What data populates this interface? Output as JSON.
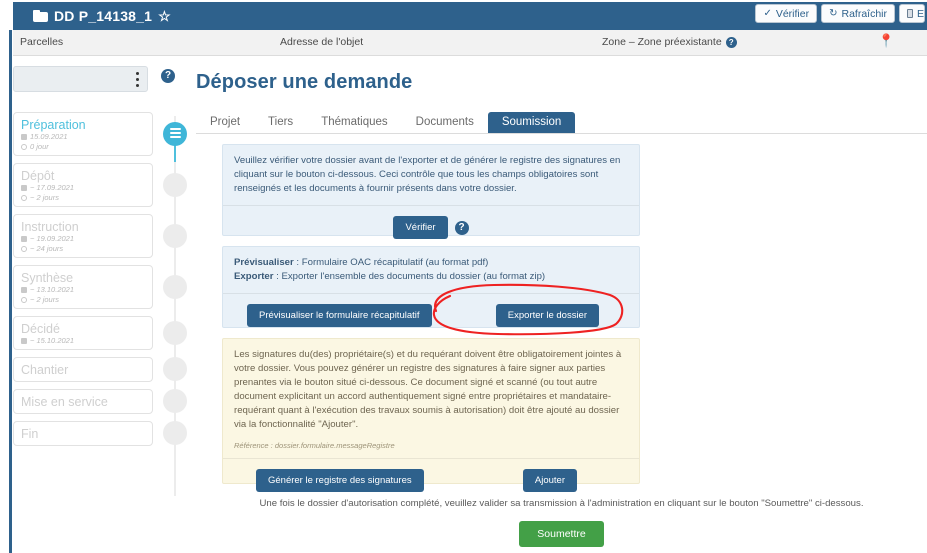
{
  "window": {
    "title": "DD P_14138_1",
    "folder_icon": "folder-icon",
    "favorite_icon": "star-icon"
  },
  "toolbar": {
    "verify_label": "Vérifier",
    "refresh_label": "Rafraîchir",
    "third_label": "E",
    "check_icon": "check-icon",
    "refresh_icon": "refresh-icon",
    "doc_icon": "document-icon"
  },
  "subheader": {
    "parcelles": "Parcelles",
    "adresse": "Adresse de l'objet",
    "zone": "Zone – Zone préexistante",
    "zone_help": "?",
    "pin_icon": "map-pin-icon"
  },
  "sidebar": {
    "help_icon_label": "?",
    "kebab_label": "more-options",
    "steps": [
      {
        "name": "Préparation",
        "date": "15.09.2021",
        "duration": "0 jour",
        "state": "active"
      },
      {
        "name": "Dépôt",
        "date": "~ 17.09.2021",
        "duration": "~ 2 jours",
        "state": "pending"
      },
      {
        "name": "Instruction",
        "date": "~ 19.09.2021",
        "duration": "~ 24 jours",
        "state": "pending"
      },
      {
        "name": "Synthèse",
        "date": "~ 13.10.2021",
        "duration": "~ 2 jours",
        "state": "pending"
      },
      {
        "name": "Décidé",
        "date": "~ 15.10.2021",
        "duration": "",
        "state": "pending"
      },
      {
        "name": "Chantier",
        "date": "",
        "duration": "",
        "state": "pending"
      },
      {
        "name": "Mise en service",
        "date": "",
        "duration": "",
        "state": "pending"
      },
      {
        "name": "Fin",
        "date": "",
        "duration": "",
        "state": "pending"
      }
    ]
  },
  "main": {
    "title": "Déposer une demande",
    "tabs": [
      {
        "label": "Projet",
        "active": false
      },
      {
        "label": "Tiers",
        "active": false
      },
      {
        "label": "Thématiques",
        "active": false
      },
      {
        "label": "Documents",
        "active": false
      },
      {
        "label": "Soumission",
        "active": true
      }
    ],
    "panel_verify": {
      "text": "Veuillez vérifier votre dossier avant de l'exporter et de générer le registre des signatures en cliquant sur le bouton ci-dessous. Ceci contrôle que tous les champs obligatoires sont renseignés et les documents à fournir présents dans votre dossier.",
      "button": "Vérifier",
      "help": "?"
    },
    "panel_export": {
      "line1_label": "Prévisualiser",
      "line1_text": " : Formulaire OAC récapitulatif (au format pdf)",
      "line2_label": "Exporter",
      "line2_text": " : Exporter l'ensemble des documents du dossier (au format zip)",
      "button_preview": "Prévisualiser le formulaire récapitulatif",
      "button_export": "Exporter le dossier"
    },
    "panel_signatures": {
      "text": "Les signatures du(des) propriétaire(s) et du requérant doivent être obligatoirement jointes à votre dossier. Vous pouvez générer un registre des signatures à faire signer aux parties prenantes via le bouton situé ci-dessous. Ce document signé et scanné (ou tout autre document explicitant un accord authentiquement signé entre propriétaires et mandataire-requérant quant à l'exécution des travaux soumis à autorisation) doit être ajouté au dossier via la fonctionnalité \"Ajouter\".",
      "reference": "Référence : dossier.formulaire.messageRegistre",
      "button_generate": "Générer le registre des signatures",
      "button_add": "Ajouter"
    },
    "footer": {
      "note": "Une fois le dossier d'autorisation complété, veuillez valider sa transmission à l'administration en cliquant sur le bouton \"Soumettre\" ci-dessous.",
      "submit_label": "Soumettre"
    }
  },
  "annotation": {
    "shape": "red-ellipse",
    "color": "#ee2222",
    "targets": "button-preview-recap-form"
  },
  "colors": {
    "header_blue": "#2e618c",
    "accent_cyan": "#3fb6d8",
    "panel_blue": "#e9f1f8",
    "panel_cream": "#fbf7e3",
    "submit_green": "#43a047",
    "annotation_red": "#ee2222"
  }
}
